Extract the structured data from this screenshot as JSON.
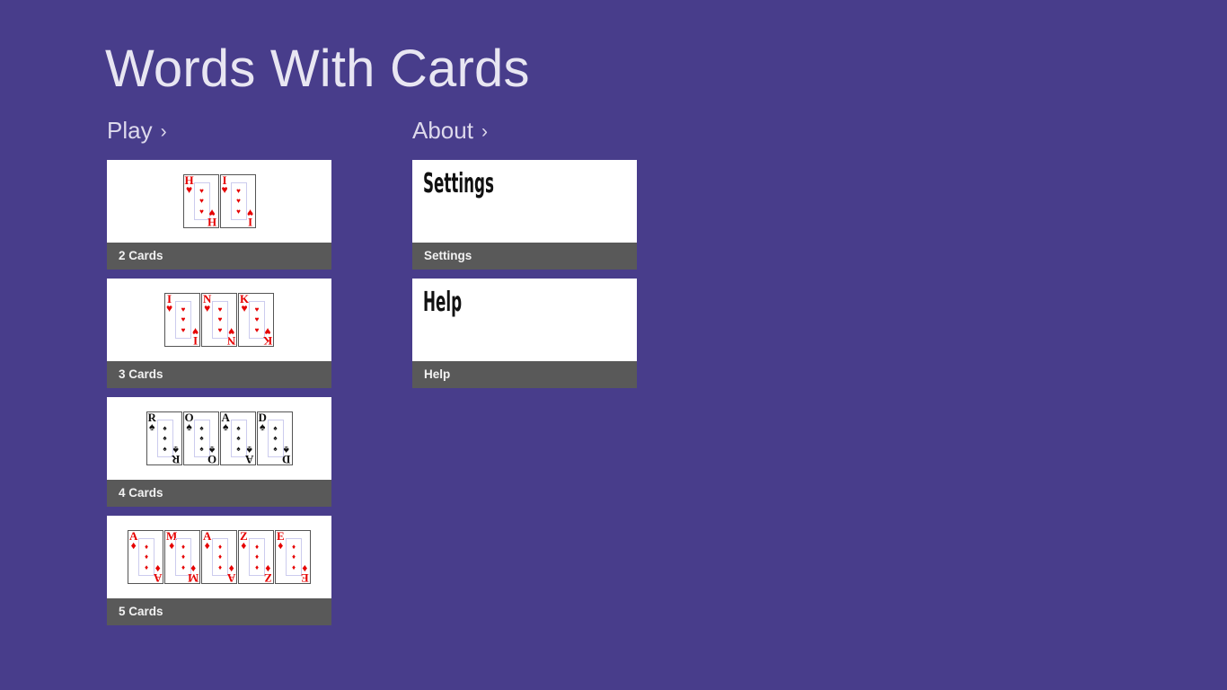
{
  "app": {
    "title": "Words With Cards",
    "background_color": "#483d8b",
    "tile_label_color": "#595959",
    "tile_art_color": "#ffffff",
    "title_color": "#e8e6f2"
  },
  "groups": [
    {
      "name": "play",
      "header": {
        "label": "Play",
        "chevron": "›"
      },
      "tiles": [
        {
          "name": "2-cards",
          "label": "2 Cards",
          "art_type": "cards",
          "cards": [
            {
              "rank": "H",
              "suit": "♥",
              "suit_name": "hearts",
              "color": "red"
            },
            {
              "rank": "I",
              "suit": "♥",
              "suit_name": "hearts",
              "color": "red"
            }
          ]
        },
        {
          "name": "3-cards",
          "label": "3 Cards",
          "art_type": "cards",
          "cards": [
            {
              "rank": "I",
              "suit": "♥",
              "suit_name": "hearts",
              "color": "red"
            },
            {
              "rank": "N",
              "suit": "♥",
              "suit_name": "hearts",
              "color": "red"
            },
            {
              "rank": "K",
              "suit": "♥",
              "suit_name": "hearts",
              "color": "red"
            }
          ]
        },
        {
          "name": "4-cards",
          "label": "4 Cards",
          "art_type": "cards",
          "cards": [
            {
              "rank": "R",
              "suit": "♠",
              "suit_name": "spades",
              "color": "black"
            },
            {
              "rank": "O",
              "suit": "♠",
              "suit_name": "spades",
              "color": "black"
            },
            {
              "rank": "A",
              "suit": "♠",
              "suit_name": "spades",
              "color": "black"
            },
            {
              "rank": "D",
              "suit": "♠",
              "suit_name": "spades",
              "color": "black"
            }
          ]
        },
        {
          "name": "5-cards",
          "label": "5 Cards",
          "art_type": "cards",
          "cards": [
            {
              "rank": "A",
              "suit": "♦",
              "suit_name": "diamonds",
              "color": "red"
            },
            {
              "rank": "M",
              "suit": "♦",
              "suit_name": "diamonds",
              "color": "red"
            },
            {
              "rank": "A",
              "suit": "♦",
              "suit_name": "diamonds",
              "color": "red"
            },
            {
              "rank": "Z",
              "suit": "♦",
              "suit_name": "diamonds",
              "color": "red"
            },
            {
              "rank": "E",
              "suit": "♦",
              "suit_name": "diamonds",
              "color": "red"
            }
          ]
        }
      ]
    },
    {
      "name": "about",
      "header": {
        "label": "About",
        "chevron": "›"
      },
      "tiles": [
        {
          "name": "settings",
          "label": "Settings",
          "art_type": "text",
          "art_text": "Settings"
        },
        {
          "name": "help",
          "label": "Help",
          "art_type": "text",
          "art_text": "Help"
        }
      ]
    }
  ]
}
